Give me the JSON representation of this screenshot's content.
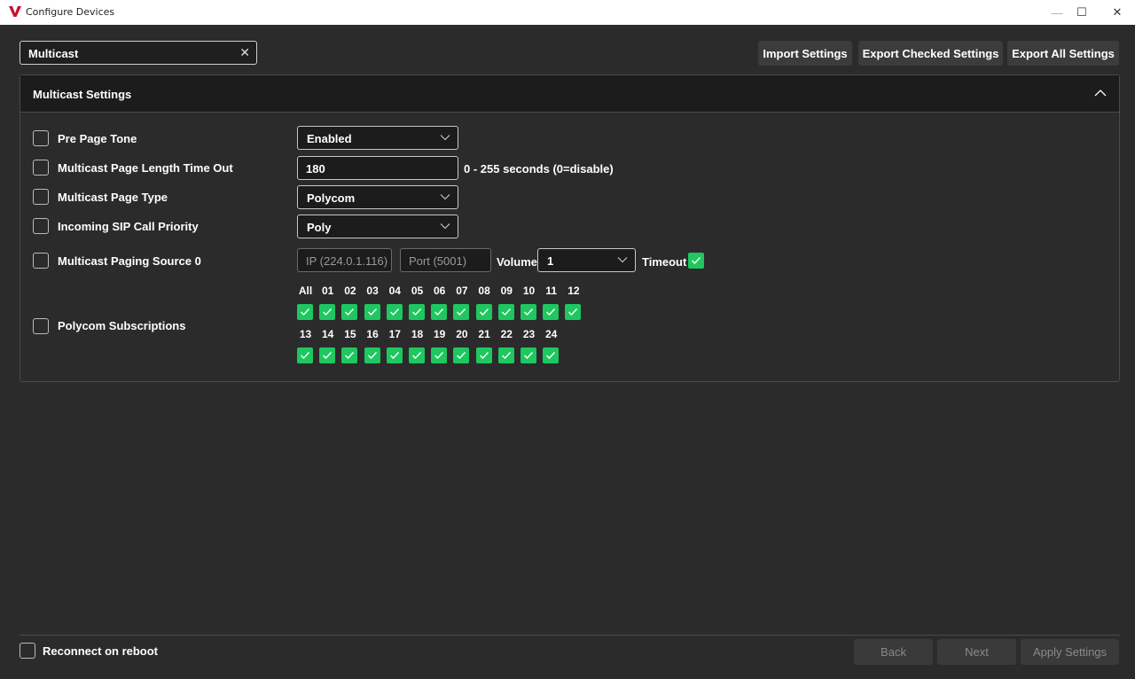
{
  "window": {
    "title": "Configure Devices",
    "minimize_glyph": "—",
    "maximize_glyph": "☐",
    "close_glyph": "✕",
    "logo_color": "#c8102e"
  },
  "search": {
    "value": "Multicast",
    "clear_glyph": "✕"
  },
  "toolbar": {
    "import_label": "Import Settings",
    "export_checked_label": "Export Checked Settings",
    "export_all_label": "Export All Settings"
  },
  "panel": {
    "title": "Multicast Settings",
    "collapse_icon": "chevron-up-icon",
    "rows": {
      "pre_page_tone": {
        "label": "Pre Page Tone",
        "value": "Enabled"
      },
      "length_timeout": {
        "label": "Multicast Page Length Time Out",
        "value": "180",
        "hint": "0 - 255 seconds (0=disable)"
      },
      "page_type": {
        "label": "Multicast Page Type",
        "value": "Polycom"
      },
      "sip_priority": {
        "label": "Incoming SIP Call Priority",
        "value": "Poly"
      },
      "paging_source": {
        "label": "Multicast Paging Source 0",
        "ip_placeholder": "IP (224.0.1.116)",
        "port_placeholder": "Port (5001)",
        "volume_label": "Volume",
        "volume_value": "1",
        "timeout_label": "Timeout",
        "timeout_checked": true
      },
      "subscriptions": {
        "label": "Polycom Subscriptions",
        "group1": [
          "All",
          "01",
          "02",
          "03",
          "04",
          "05",
          "06",
          "07",
          "08",
          "09",
          "10",
          "11",
          "12"
        ],
        "group2": [
          "13",
          "14",
          "15",
          "16",
          "17",
          "18",
          "19",
          "20",
          "21",
          "22",
          "23",
          "24"
        ]
      }
    }
  },
  "footer": {
    "reconnect_label": "Reconnect on reboot",
    "back_label": "Back",
    "next_label": "Next",
    "apply_label": "Apply Settings"
  },
  "colors": {
    "background": "#2b2b2b",
    "header": "#1c1c1c",
    "check_green": "#1ec760",
    "button": "#3c3c3c",
    "disabled_text": "#8a8a8a"
  }
}
